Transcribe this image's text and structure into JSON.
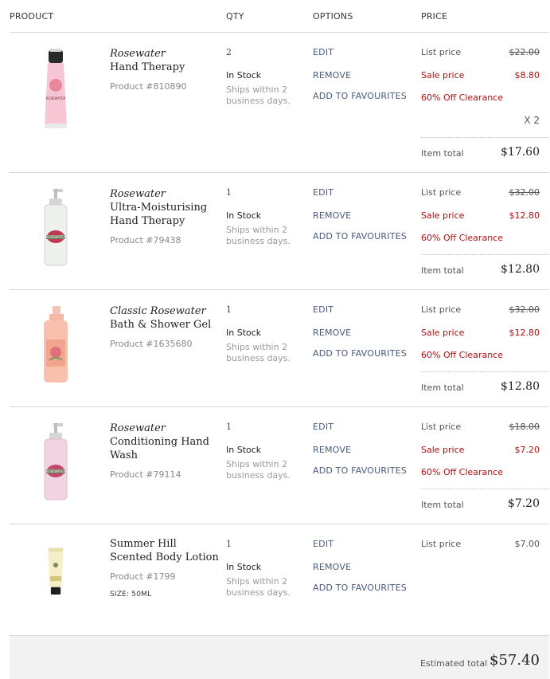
{
  "header": {
    "product": "PRODUCT",
    "qty": "QTY",
    "options": "OPTIONS",
    "price": "PRICE"
  },
  "options": {
    "edit": "EDIT",
    "remove": "REMOVE",
    "favourite": "ADD TO FAVOURITES"
  },
  "labels": {
    "list": "List price",
    "sale": "Sale price",
    "clearance": "60% Off Clearance",
    "item_total": "Item total",
    "in_stock": "In Stock",
    "ships": "Ships within 2 business days."
  },
  "items": [
    {
      "brand": "Rosewater",
      "name": "Hand Therapy",
      "number": "Product #810890",
      "qty": "2",
      "list_price": "$22.00",
      "sale_price": "$8.80",
      "multiplier": "X 2",
      "item_total": "$17.60"
    },
    {
      "brand": "Rosewater",
      "name": "Ultra-Moisturising Hand Therapy",
      "number": "Product #79438",
      "qty": "1",
      "list_price": "$32.00",
      "sale_price": "$12.80",
      "item_total": "$12.80"
    },
    {
      "brand": "Classic Rosewater",
      "name": "Bath & Shower Gel",
      "number": "Product #1635680",
      "qty": "1",
      "list_price": "$32.00",
      "sale_price": "$12.80",
      "item_total": "$12.80"
    },
    {
      "brand": "Rosewater",
      "name": "Conditioning Hand Wash",
      "number": "Product #79114",
      "qty": "1",
      "list_price": "$18.00",
      "sale_price": "$7.20",
      "item_total": "$7.20"
    },
    {
      "name": "Summer Hill Scented Body Lotion",
      "number": "Product #1799",
      "size": "SIZE: 50ML",
      "qty": "1",
      "list_price": "$7.00"
    }
  ],
  "footer": {
    "label": "Estimated total",
    "value": "$57.40"
  },
  "colors": {
    "sale": "#aa1111",
    "link": "#4a5a7c",
    "footer_bg": "#f2f2f2"
  }
}
